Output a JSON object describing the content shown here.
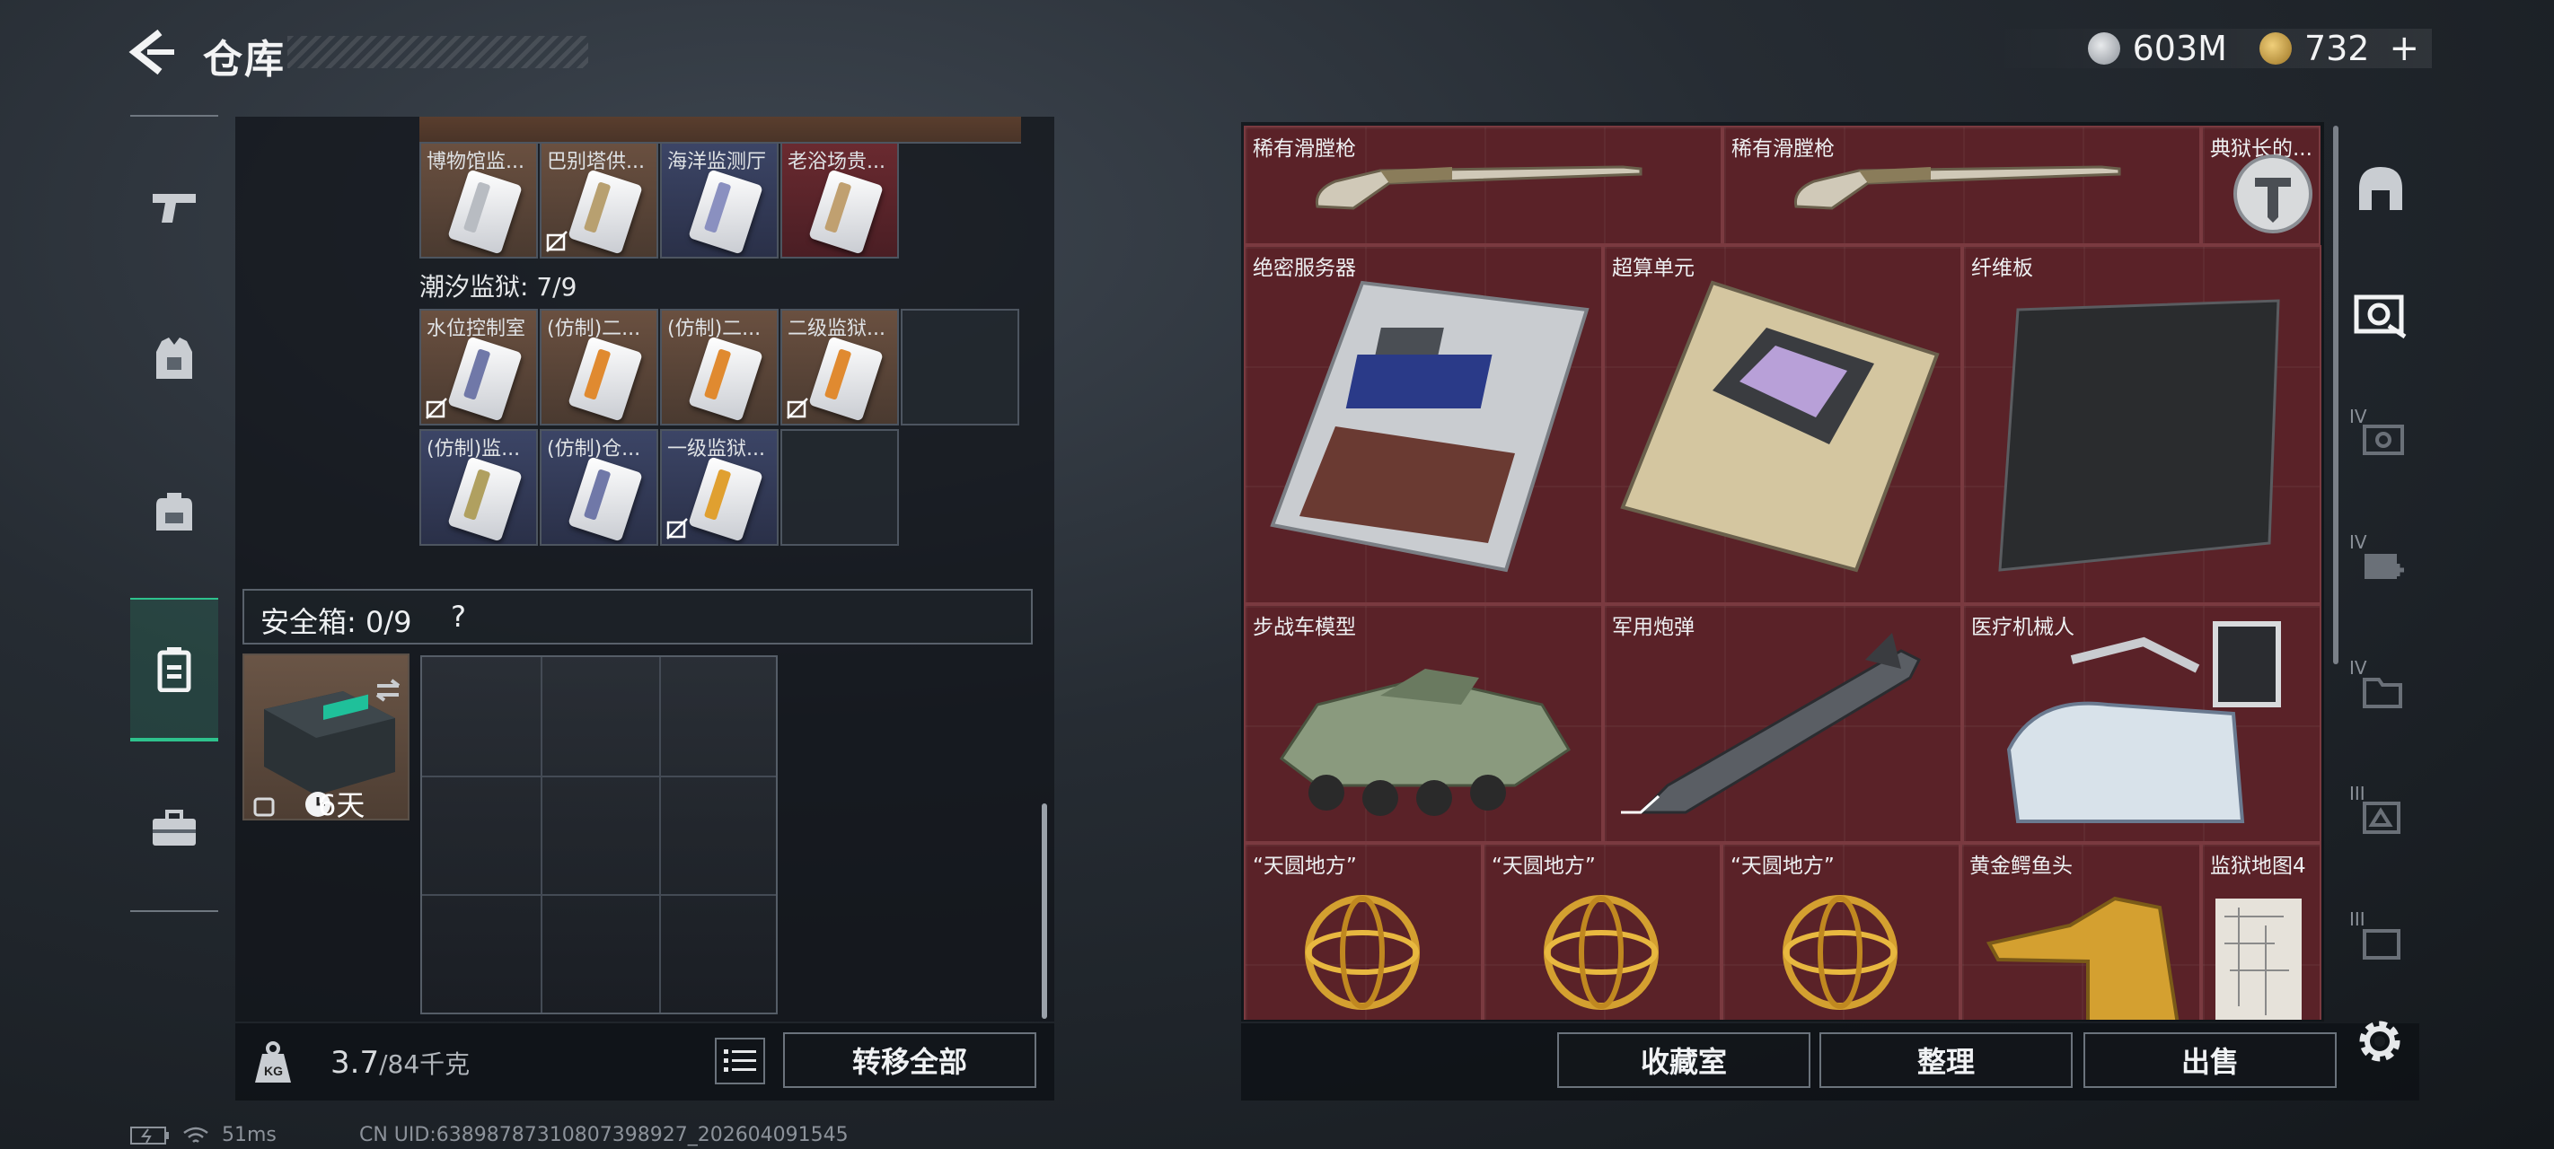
{
  "header": {
    "title": "仓库",
    "currency": [
      {
        "icon": "silver-coin-icon",
        "value": "603M"
      },
      {
        "icon": "gold-coin-icon",
        "value": "732"
      }
    ],
    "plus": "+"
  },
  "left": {
    "top_row": [
      {
        "label": "博物馆监...",
        "bg": "brown",
        "nodrop": false
      },
      {
        "label": "巴别塔供...",
        "bg": "brown",
        "nodrop": true
      },
      {
        "label": "海洋监测厅",
        "bg": "blue",
        "nodrop": false
      },
      {
        "label": "老浴场贵...",
        "bg": "red",
        "nodrop": false
      }
    ],
    "prison_label": "潮汐监狱: 7/9",
    "prison_row1": [
      {
        "label": "水位控制室",
        "bg": "brown",
        "nodrop": true
      },
      {
        "label": "(仿制)二...",
        "bg": "brown",
        "nodrop": false
      },
      {
        "label": "(仿制)二...",
        "bg": "brown",
        "nodrop": false
      },
      {
        "label": "二级监狱...",
        "bg": "brown",
        "nodrop": true
      }
    ],
    "prison_row2": [
      {
        "label": "(仿制)监...",
        "bg": "blue",
        "nodrop": false
      },
      {
        "label": "(仿制)仓...",
        "bg": "blue",
        "nodrop": false
      },
      {
        "label": "一级监狱...",
        "bg": "blue",
        "nodrop": true
      }
    ],
    "safe_label": "安全箱: 0/9",
    "safe_help": "?",
    "safe_days": "6天",
    "weight_value": "3.7",
    "weight_max": "/84千克",
    "transfer_all": "转移全部"
  },
  "right": {
    "items": [
      {
        "label": "稀有滑膛枪",
        "icon": "musket-icon"
      },
      {
        "label": "稀有滑膛枪",
        "icon": "musket-icon"
      },
      {
        "label": "典狱长的...",
        "icon": "warden-badge-icon"
      },
      {
        "label": "绝密服务器",
        "icon": "server-icon"
      },
      {
        "label": "超算单元",
        "icon": "supercomputer-unit-icon"
      },
      {
        "label": "纤维板",
        "icon": "fiber-board-icon"
      },
      {
        "label": "步战车模型",
        "icon": "ifv-model-icon"
      },
      {
        "label": "军用炮弹",
        "icon": "artillery-shell-icon"
      },
      {
        "label": "医疗机械人",
        "icon": "medical-robot-icon"
      },
      {
        "label": "“天圆地方”",
        "icon": "armillary-sphere-icon"
      },
      {
        "label": "“天圆地方”",
        "icon": "armillary-sphere-icon"
      },
      {
        "label": "“天圆地方”",
        "icon": "armillary-sphere-icon"
      },
      {
        "label": "黄金鳄鱼头",
        "icon": "gold-crocodile-head-icon"
      },
      {
        "label": "监狱地图4",
        "icon": "prison-map-icon"
      }
    ],
    "buttons": {
      "collection": "收藏室",
      "sort": "整理",
      "sell": "出售"
    },
    "filter_tiers": [
      "IV",
      "IV",
      "IV",
      "III",
      "III"
    ]
  },
  "status": {
    "ping": "51ms",
    "uid": "CN UID:638987873108073989​27_202604091545"
  },
  "colors": {
    "accent": "#2ec28d",
    "item_red": "#5a2228",
    "panel": "#10141a"
  }
}
